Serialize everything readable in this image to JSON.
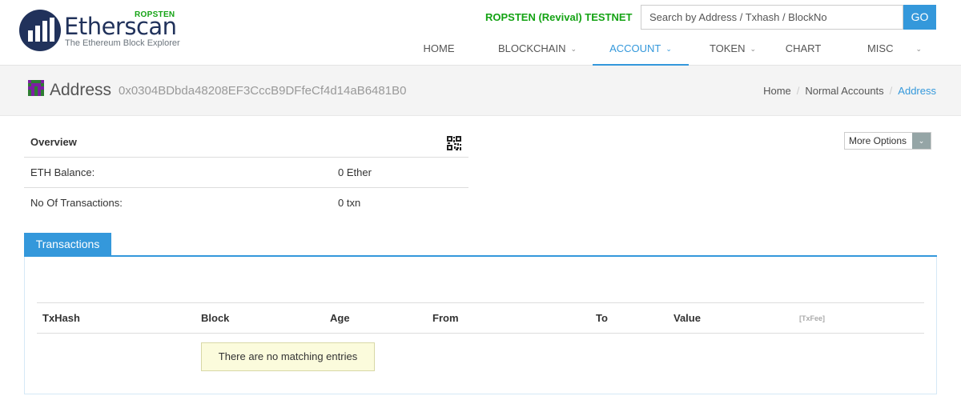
{
  "header": {
    "logo_word": "Etherscan",
    "logo_subtitle": "The Ethereum Block Explorer",
    "logo_network": "ROPSTEN",
    "network_label": "ROPSTEN (Revival) TESTNET",
    "search": {
      "placeholder": "Search by Address / Txhash / BlockNo",
      "button_label": "GO"
    },
    "nav": [
      {
        "label": "HOME",
        "dropdown": false
      },
      {
        "label": "BLOCKCHAIN",
        "dropdown": true
      },
      {
        "label": "ACCOUNT",
        "dropdown": true,
        "active": true
      },
      {
        "label": "TOKEN",
        "dropdown": true
      },
      {
        "label": "CHART",
        "dropdown": false
      },
      {
        "label": "MISC",
        "dropdown": true
      }
    ]
  },
  "title_bar": {
    "title": "Address",
    "address": "0x0304BDbda48208EF3CccB9DFfeCf4d14aB6481B0",
    "breadcrumb": [
      "Home",
      "Normal Accounts",
      "Address"
    ]
  },
  "overview": {
    "heading": "Overview",
    "rows": [
      {
        "label": "ETH Balance:",
        "value": "0 Ether"
      },
      {
        "label": "No Of Transactions:",
        "value": "0 txn"
      }
    ]
  },
  "more_options": {
    "label": "More Options"
  },
  "transactions": {
    "tab_label": "Transactions",
    "columns": [
      "TxHash",
      "Block",
      "Age",
      "From",
      "To",
      "Value",
      "[TxFee]"
    ],
    "empty_message": "There are no matching entries"
  },
  "colors": {
    "accent": "#3498db",
    "brand_navy": "#21325b",
    "testnet_green": "#14a314"
  },
  "icons": [
    "etherscan-logo-icon",
    "chevron-down-icon",
    "identicon-icon",
    "qr-code-icon",
    "caret-down-icon"
  ]
}
